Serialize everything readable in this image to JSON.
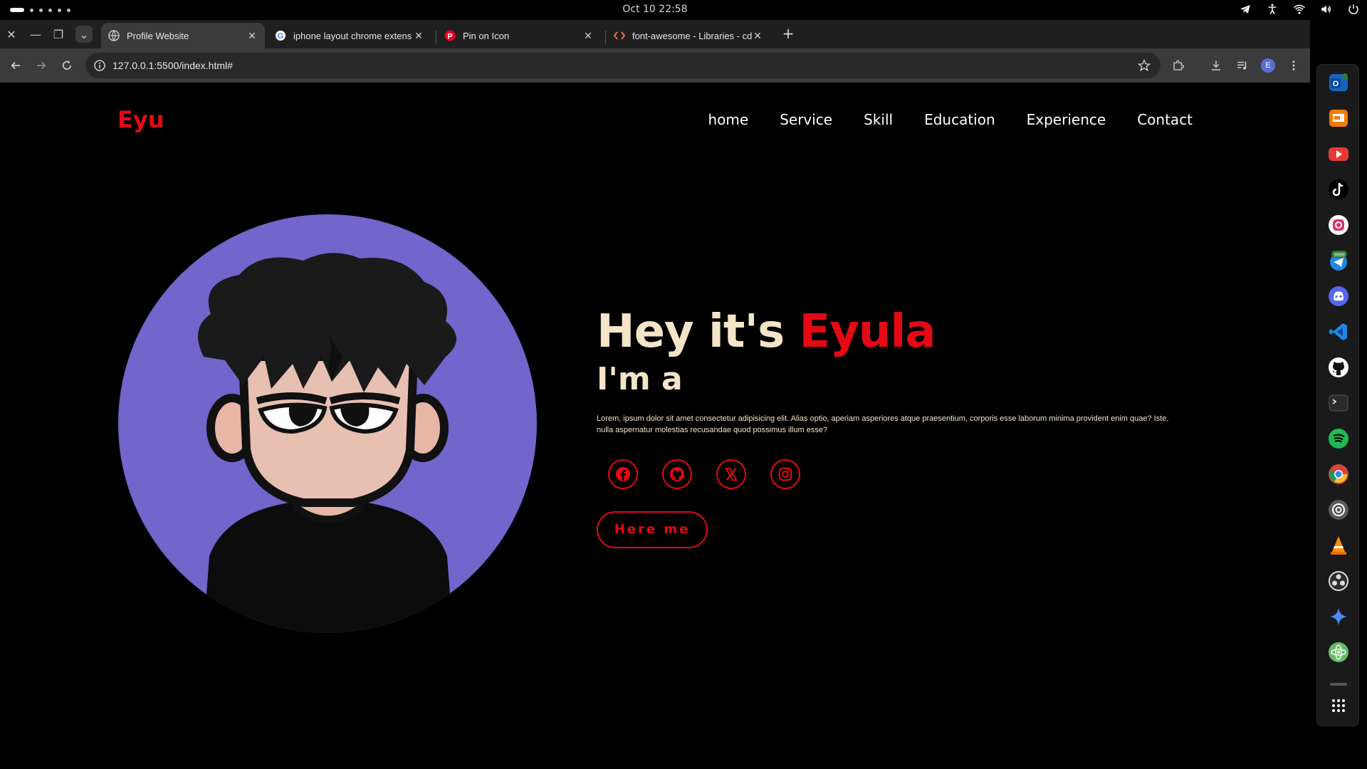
{
  "topbar": {
    "datetime": "Oct 10  22:58",
    "icons": [
      "telegram-icon",
      "accessibility-icon",
      "wifi-icon",
      "volume-icon",
      "power-icon"
    ]
  },
  "browser": {
    "tabs": [
      {
        "title": "Profile Website",
        "icon": "globe-icon",
        "active": true
      },
      {
        "title": "iphone layout chrome extens",
        "icon": "google-icon",
        "active": false
      },
      {
        "title": "Pin on Icon",
        "icon": "pinterest-icon",
        "active": false
      },
      {
        "title": "font-awesome - Libraries - cd",
        "icon": "code-icon",
        "active": false
      }
    ],
    "url": "127.0.0.1:5500/index.html#",
    "profile_initial": "E"
  },
  "page": {
    "logo": "Eyu",
    "nav": [
      "home",
      "Service",
      "Skill",
      "Education",
      "Experience",
      "Contact"
    ],
    "greeting_prefix": "Hey it's ",
    "greeting_name": "Eyula",
    "subtitle": "I'm a",
    "description": "Lorem, ipsum dolor sit amet consectetur adipisicing elit. Alias optio, aperiam asperiores atque praesentium, corporis esse laborum minima provident enim quae? Iste, nulla aspernatur molestias recusandae quod possimus illum esse?",
    "socials": [
      "facebook-icon",
      "github-icon",
      "x-icon",
      "instagram-icon"
    ],
    "cta_label": "Here me",
    "colors": {
      "accent": "#e50914",
      "text": "#f4e4c8",
      "avatar_bg": "#7265cc",
      "background": "#000000"
    }
  },
  "dock": {
    "apps": [
      "outlook-icon",
      "presentation-icon",
      "youtube-icon",
      "tiktok-icon",
      "instagram-icon",
      "telegram-icon",
      "discord-icon",
      "vscode-icon",
      "github-icon",
      "terminal-icon",
      "spotify-icon",
      "chrome-icon",
      "chatgpt-icon",
      "vlc-icon",
      "obs-icon",
      "gemini-icon",
      "atom-icon",
      "app-grid-icon"
    ],
    "telegram_badge": "9999"
  }
}
